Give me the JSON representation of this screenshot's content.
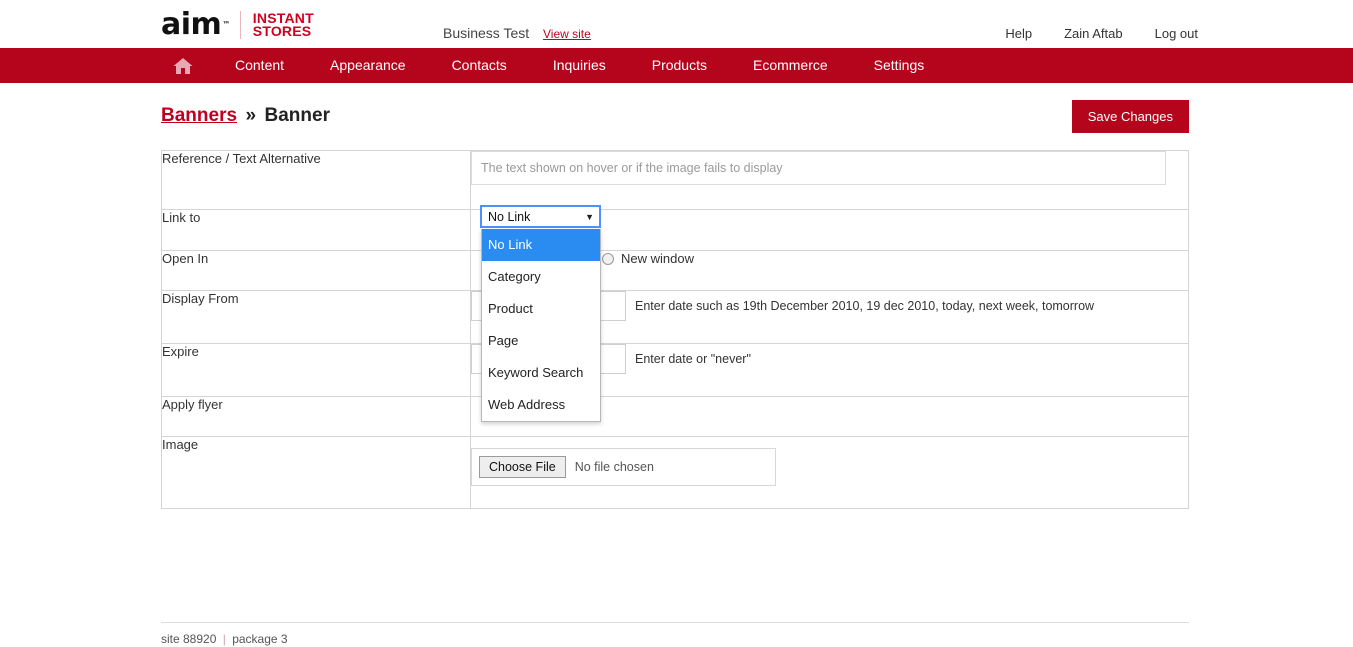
{
  "header": {
    "logo_aim": "aim",
    "logo_tm": "™",
    "logo_line1": "INSTANT",
    "logo_line2": "STORES",
    "site_name": "Business Test",
    "view_site": "View site",
    "links": [
      "Help",
      "Zain Aftab",
      "Log out"
    ]
  },
  "nav": {
    "home_icon": "home-icon",
    "items": [
      "Content",
      "Appearance",
      "Contacts",
      "Inquiries",
      "Products",
      "Ecommerce",
      "Settings"
    ]
  },
  "page": {
    "breadcrumb_link": "Banners",
    "breadcrumb_sep": "»",
    "breadcrumb_current": "Banner",
    "save_label": "Save Changes"
  },
  "form": {
    "rows": {
      "reference": {
        "label": "Reference / Text Alternative",
        "placeholder": "The text shown on hover or if the image fails to display",
        "value": ""
      },
      "link_to": {
        "label": "Link to",
        "selected": "No Link",
        "arrow": "▼",
        "options": [
          "No Link",
          "Category",
          "Product",
          "Page",
          "Keyword Search",
          "Web Address"
        ]
      },
      "open_in": {
        "label": "Open In",
        "radio_label": "New window",
        "checked": false
      },
      "display_from": {
        "label": "Display From",
        "value": "",
        "hint": "Enter date such as 19th December 2010, 19 dec 2010, today, next week, tomorrow"
      },
      "expire": {
        "label": "Expire",
        "value": "",
        "hint": "Enter date or \"never\""
      },
      "apply_flyer": {
        "label": "Apply flyer"
      },
      "image": {
        "label": "Image",
        "choose_file": "Choose File",
        "file_status": "No file chosen"
      }
    }
  },
  "footer": {
    "site": "site 88920",
    "separator": "|",
    "package": "package 3"
  },
  "colors": {
    "brand_red": "#b5051c",
    "link_red": "#c00020",
    "logo_red": "#d1001f",
    "highlight_blue": "#2a8cf0",
    "focus_blue": "#4d90fe"
  }
}
